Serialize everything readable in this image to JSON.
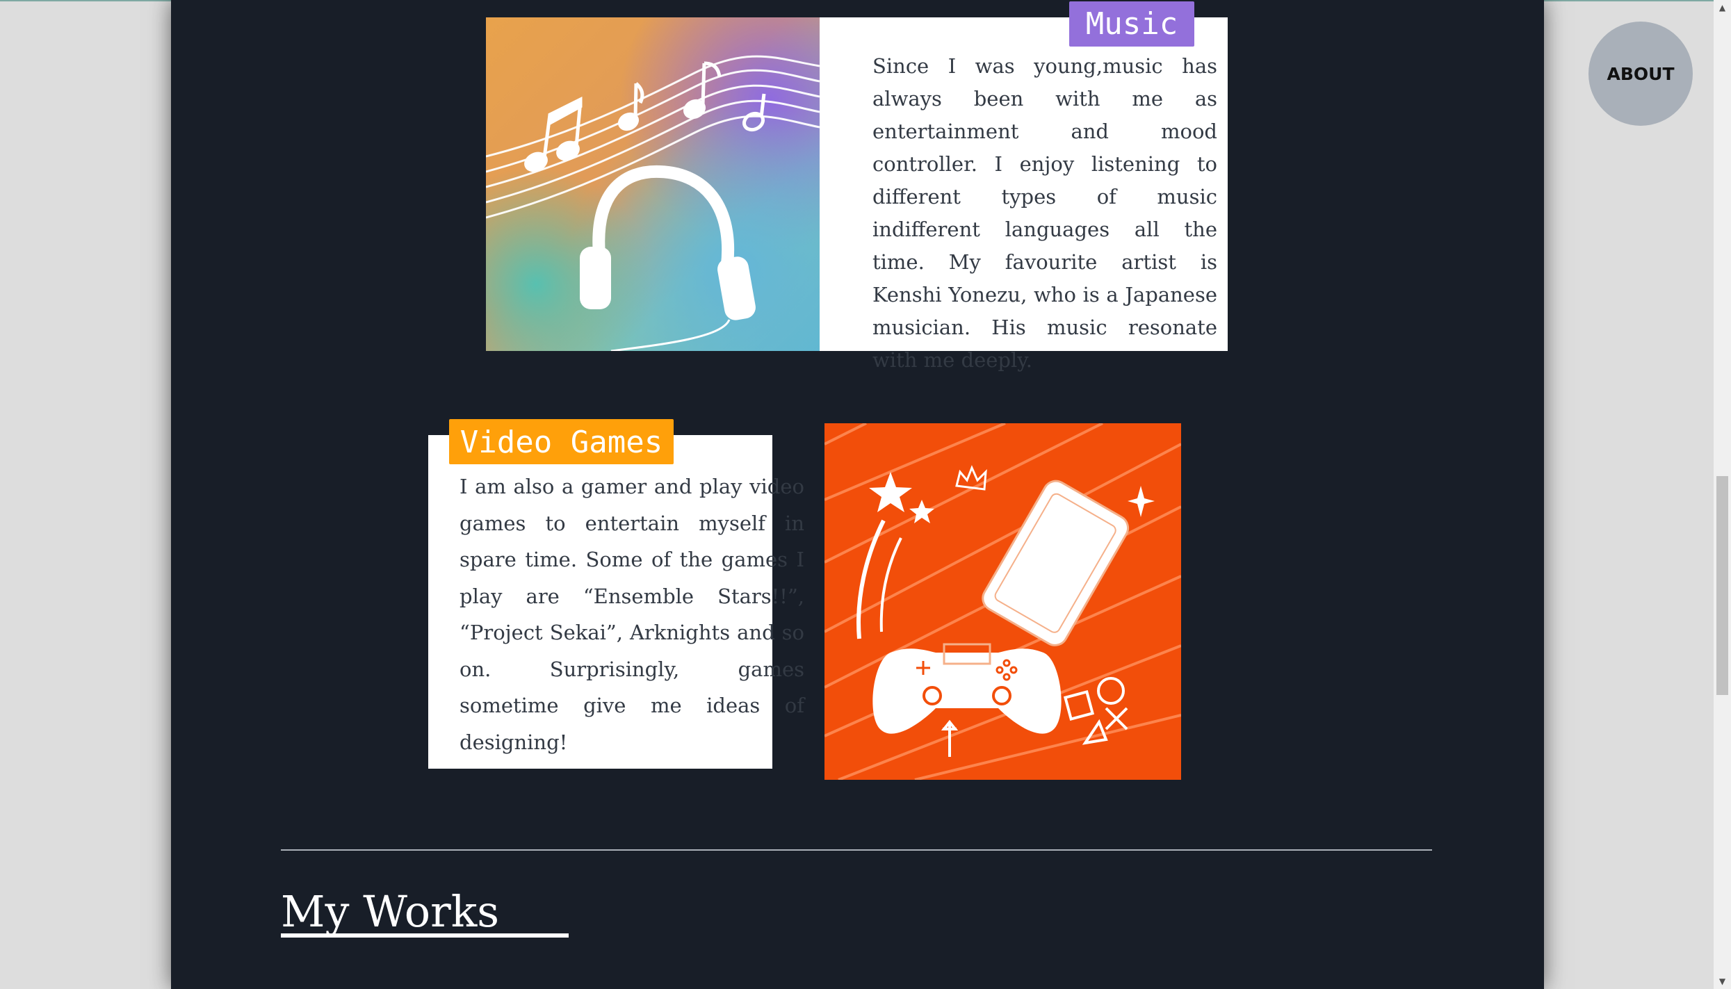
{
  "hobbies": {
    "music": {
      "tag": "Music",
      "text": "Since I was young,music has always been with me as entertainment and mood controller. I enjoy listening to different types of music indifferent languages all the time. My favourite artist is Kenshi Yonezu, who is a Japanese musician. His music resonate with me deeply.",
      "image_icon": "headphones-music-notes-illustration"
    },
    "games": {
      "tag": "Video Games",
      "text": "I am also a gamer and play video games to entertain myself in spare time. Some of the games I play are “Ensemble Stars!!”, “Project Sekai”, Arknights and so on. Surprisingly, games sometime give me ideas of designing!",
      "image_icon": "game-controller-phone-illustration"
    }
  },
  "works": {
    "title": "My Works"
  },
  "nav": {
    "about_label": "ABOUT"
  },
  "colors": {
    "page_background": "#181e28",
    "music_tag": "#9370db",
    "games_tag": "#ffa00a",
    "games_image_bg": "#f24e0a"
  }
}
